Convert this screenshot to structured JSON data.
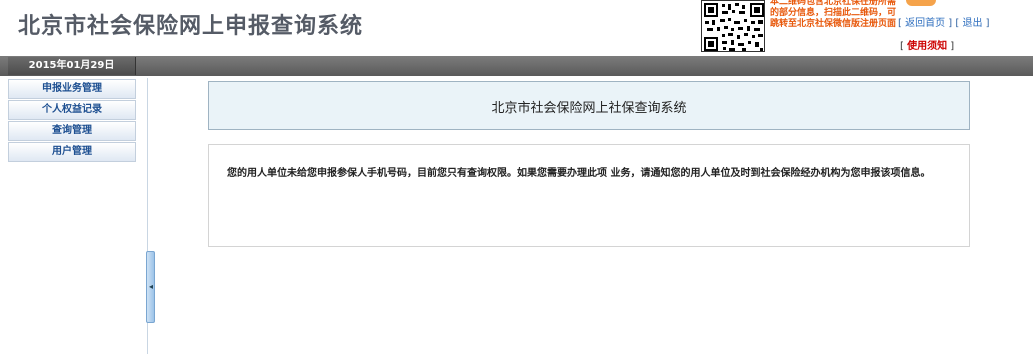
{
  "header": {
    "site_title": "北京市社会保险网上申报查询系统",
    "qr_note": "本二维码包含北京社保在册所需的部分信息，扫描此二维码，可跳转至北京社保微信版注册页面",
    "return_home": "返回首页",
    "logout": "退出",
    "help": "使用须知",
    "bracket_open": "[",
    "bracket_close": "]"
  },
  "topbar": {
    "date": "2015年01月29日"
  },
  "sidebar": {
    "items": [
      {
        "label": "申报业务管理"
      },
      {
        "label": "个人权益记录"
      },
      {
        "label": "查询管理"
      },
      {
        "label": "用户管理"
      }
    ],
    "collapse_glyph": "◂"
  },
  "main": {
    "title": "北京市社会保险网上社保查询系统",
    "message": "您的用人单位未给您申报参保人手机号码，目前您只有查询权限。如果您需要办理此项 业务，请通知您的用人单位及时到社会保险经办机构为您申报该项信息。"
  },
  "colors": {
    "accent_blue": "#1d4f91",
    "warning_orange": "#e8590c",
    "help_red": "#cc0000",
    "title_panel_bg": "#eaf3f8"
  }
}
